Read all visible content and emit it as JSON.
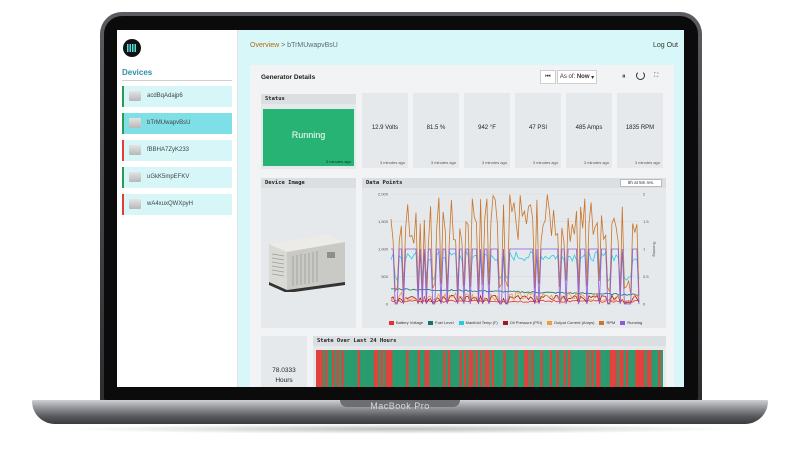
{
  "device": {
    "brand": "MacBook Pro"
  },
  "sidebar": {
    "title": "Devices",
    "items": [
      {
        "label": "acdBqAdajp6"
      },
      {
        "label": "bTrMUwapvBsU"
      },
      {
        "label": "fBBHA7ZyK233"
      },
      {
        "label": "uGkK5mpEFKV"
      },
      {
        "label": "wA4xuxQWXpyH"
      }
    ]
  },
  "header": {
    "breadcrumb_root": "Overview",
    "breadcrumb_sep": " > ",
    "breadcrumb_current": "bTrMUwapvBsU",
    "logout": "Log Out"
  },
  "details": {
    "title": "Generator Details",
    "as_of_label": "As of:",
    "as_of_value": "Now",
    "rewind_icon": "rewind-icon",
    "pause_icon": "pause-icon",
    "refresh_icon": "refresh-icon",
    "expand_icon": "expand-icon"
  },
  "status": {
    "header": "Status",
    "value": "Running",
    "ago": "3 minutes ago",
    "color": "#27b373"
  },
  "metrics": [
    {
      "value": "12.9 Volts",
      "ago": "3 minutes ago"
    },
    {
      "value": "81.5 %",
      "ago": "3 minutes ago"
    },
    {
      "value": "942 °F",
      "ago": "3 minutes ago"
    },
    {
      "value": "47 PSI",
      "ago": "3 minutes ago"
    },
    {
      "value": "485 Amps",
      "ago": "3 minutes ago"
    },
    {
      "value": "1835 RPM",
      "ago": "3 minutes ago"
    }
  ],
  "device_image": {
    "header": "Device Image"
  },
  "data_points": {
    "header": "Data Points",
    "range_button": "8h at 5m res."
  },
  "chart_data": {
    "type": "line",
    "y_left_ticks": [
      "2,000",
      "1,500",
      "1,000",
      "500",
      "0"
    ],
    "y_right_ticks": [
      "2",
      "1.5",
      "1",
      "0.5",
      "0"
    ],
    "ylabel_right": "Running",
    "ylim_left": [
      0,
      2000
    ],
    "ylim_right": [
      0,
      2
    ],
    "series": [
      {
        "name": "Battery Voltage",
        "color": "#e8312f"
      },
      {
        "name": "Fuel Level",
        "color": "#1c6e6a"
      },
      {
        "name": "Manifold Temp (F)",
        "color": "#29c9e6"
      },
      {
        "name": "Oil Pressure (PSI)",
        "color": "#a3171c"
      },
      {
        "name": "Output Current (Amps)",
        "color": "#f39a3d"
      },
      {
        "name": "RPM",
        "color": "#c9762a"
      },
      {
        "name": "Running",
        "color": "#8a5ae0"
      }
    ]
  },
  "state_24h": {
    "header": "State Over Last 24 Hours",
    "running_color": "#2a9b6f",
    "stopped_color": "#e2413c"
  },
  "hours": {
    "value": "78.0333",
    "unit": "Hours"
  }
}
